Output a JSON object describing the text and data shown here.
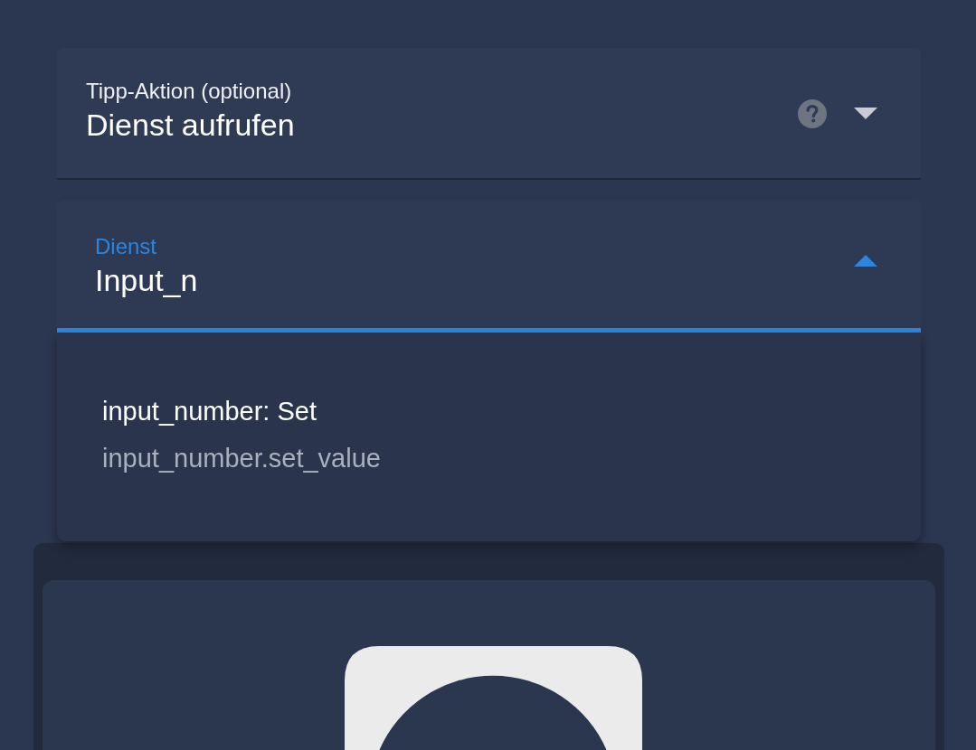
{
  "tap_action": {
    "label": "Tipp-Aktion (optional)",
    "value": "Dienst aufrufen",
    "expanded": false
  },
  "service": {
    "label": "Dienst",
    "value": "Input_n",
    "expanded": true
  },
  "suggestions": [
    {
      "title": "input_number: Set",
      "subtitle": "input_number.set_value",
      "selected": false
    }
  ]
}
